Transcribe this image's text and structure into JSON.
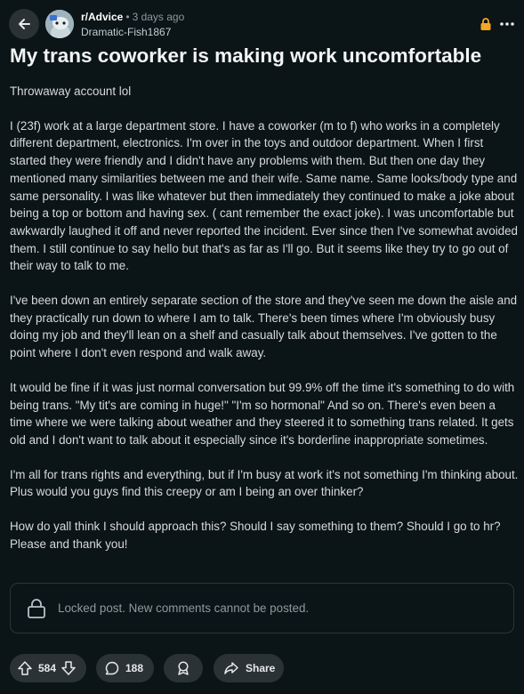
{
  "post": {
    "subreddit": "r/Advice",
    "time": "3 days ago",
    "author": "Dramatic-Fish1867",
    "title": "My trans coworker is making work uncomfortable",
    "paragraphs": [
      "Throwaway account lol",
      "I (23f) work at a large department store. I have a coworker (m to f) who works in a completely different department, electronics. I'm over in the toys and outdoor department. When I first started they were friendly and I didn't have any problems with them. But then one day they mentioned many similarities between me and their wife. Same name. Same looks/body type and same personality. I was like whatever but then immediately they continued to make a joke about being a top or bottom and having sex. ( cant remember the exact joke). I was uncomfortable but awkwardly laughed it off and never reported the incident. Ever since then I've somewhat avoided them. I still continue to say hello but that's as far as I'll go. But it seems like they try to go out of their way to talk to me.",
      "I've been down an entirely separate section of the store and they've seen me down the aisle and they practically run down to where I am to talk. There's been times where I'm obviously busy doing my job and they'll lean on a shelf and casually talk about themselves. I've gotten to the point where I don't even respond and walk away.",
      "It would be fine if it was just normal conversation but 99.9% off the time it's something to do with being trans. \"My tit's are coming in huge!\" \"I'm so hormonal\" And so on. There's even been a time where we were talking about weather and they steered it to something trans related. It gets old and I don't want to talk about it especially since it's borderline inappropriate sometimes.",
      "I'm all for trans rights and everything, but if I'm busy at work it's not something I'm thinking about. Plus would you guys find this creepy or am I being an over thinker?",
      "How do yall think I should approach this? Should I say something to them? Should I go to hr? Please and thank you!"
    ]
  },
  "locked_notice": "Locked post. New comments cannot be posted.",
  "actions": {
    "votes": "584",
    "comments": "188",
    "share_label": "Share"
  },
  "colors": {
    "background": "#0b1416",
    "pill": "#2a3236",
    "lock_accent": "#f5a623"
  },
  "icons": [
    "back-arrow-icon",
    "lock-icon",
    "more-icon",
    "upvote-icon",
    "downvote-icon",
    "comment-icon",
    "award-icon",
    "share-icon"
  ]
}
